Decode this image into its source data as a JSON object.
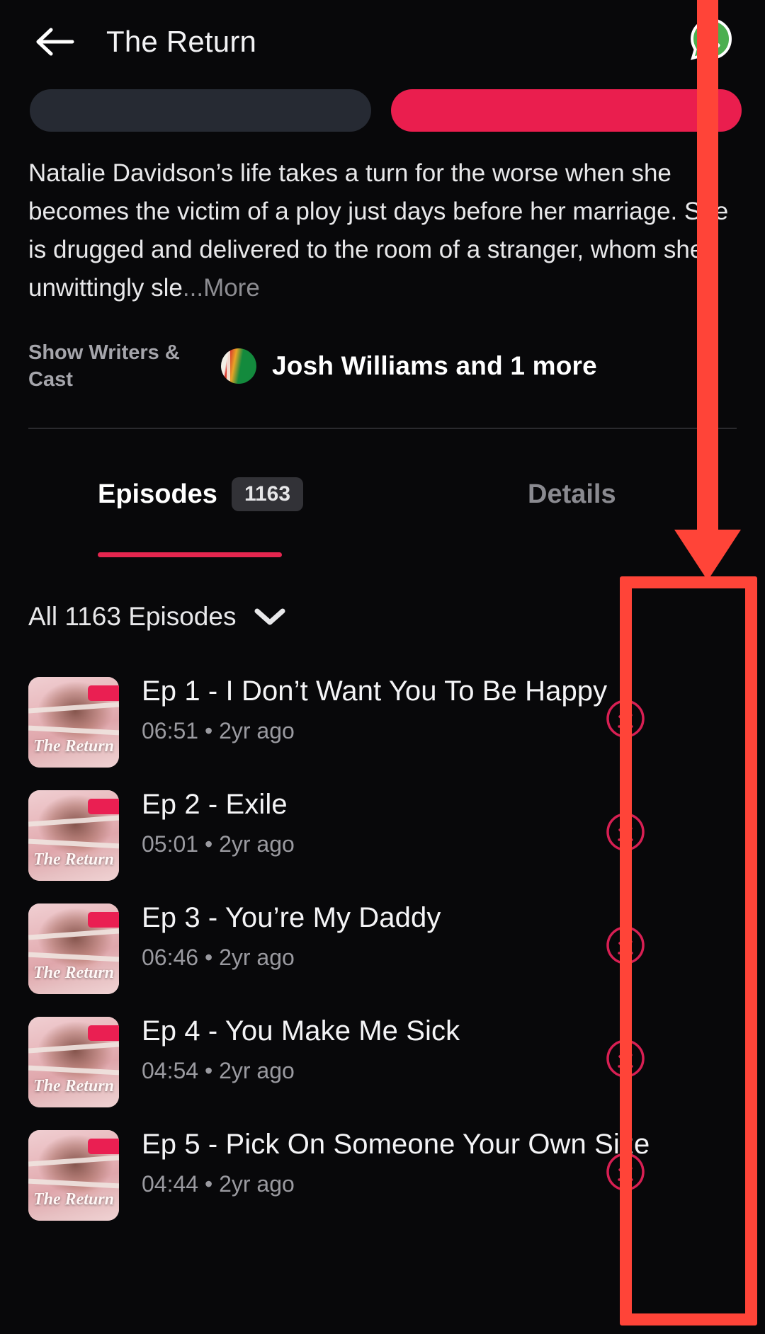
{
  "header": {
    "back_icon": "back-arrow-icon",
    "title": "The Return",
    "account_icon": "whatsapp-icon"
  },
  "action_buttons": {
    "secondary_label": "",
    "primary_label": "",
    "secondary_color": "#262a33",
    "primary_color": "#ea1e4e"
  },
  "description": {
    "text": "Natalie Davidson’s life takes a turn for the worse when she becomes the victim of a ploy just days before her marriage. She is drugged and delivered to the room of a stranger, whom she unwittingly sle",
    "more_label": "...More"
  },
  "cast": {
    "label": "Show Writers & Cast",
    "name": "Josh Williams and 1 more",
    "avatar_icon": "cast-avatar-icon"
  },
  "tabs": {
    "episodes": {
      "label": "Episodes",
      "badge": "1163"
    },
    "details": {
      "label": "Details"
    },
    "active_color": "#e5264f"
  },
  "filter": {
    "label": "All 1163 Episodes",
    "chevron_icon": "chevron-down-icon"
  },
  "episodes": [
    {
      "title": "Ep 1 - I Don’t Want You To Be Happy",
      "duration": "06:51",
      "age": "2yr ago",
      "separator": "•",
      "thumb_title": "The Return",
      "download_icon": "download-icon"
    },
    {
      "title": "Ep 2 - Exile",
      "duration": "05:01",
      "age": "2yr ago",
      "separator": "•",
      "thumb_title": "The Return",
      "download_icon": "download-icon"
    },
    {
      "title": "Ep 3 - You’re My Daddy",
      "duration": "06:46",
      "age": "2yr ago",
      "separator": "•",
      "thumb_title": "The Return",
      "download_icon": "download-icon"
    },
    {
      "title": "Ep 4 - You Make Me Sick",
      "duration": "04:54",
      "age": "2yr ago",
      "separator": "•",
      "thumb_title": "The Return",
      "download_icon": "download-icon"
    },
    {
      "title": "Ep 5 - Pick On Someone Your Own Size",
      "duration": "04:44",
      "age": "2yr ago",
      "separator": "•",
      "thumb_title": "The Return",
      "download_icon": "download-icon"
    }
  ],
  "annotation": {
    "color": "#ff4438",
    "arrow_icon": "annotation-arrow-icon",
    "box_icon": "annotation-highlight-box"
  }
}
